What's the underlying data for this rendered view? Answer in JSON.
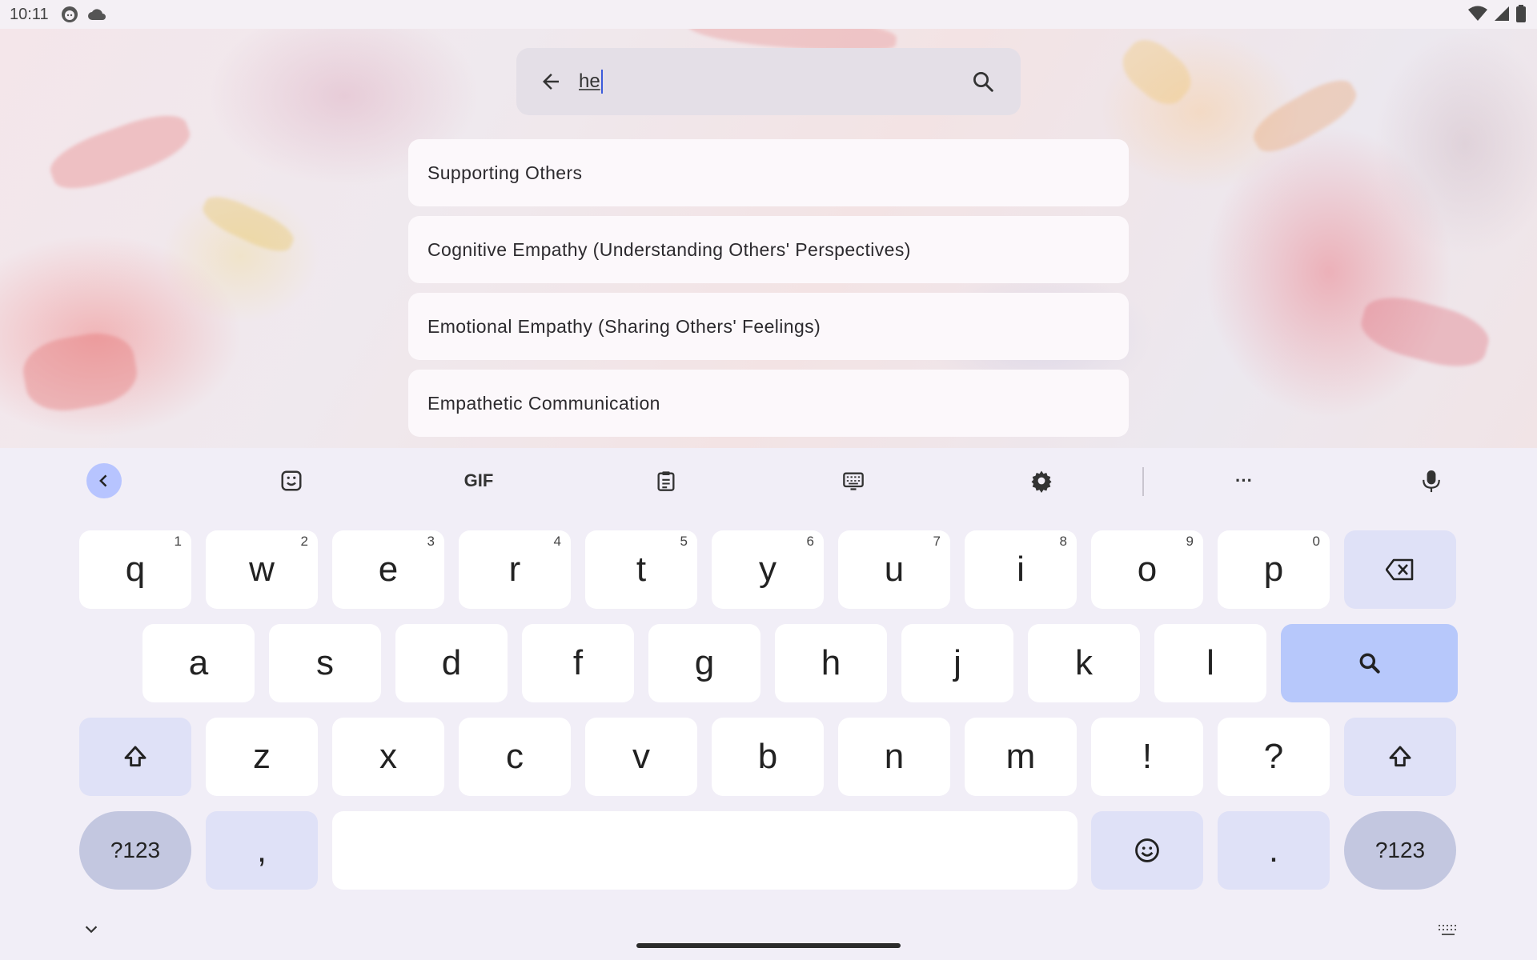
{
  "status_bar": {
    "time": "10:11"
  },
  "search": {
    "value": "he"
  },
  "suggestions": [
    "Supporting Others",
    "Cognitive Empathy (Understanding Others' Perspectives)",
    "Emotional Empathy (Sharing Others' Feelings)",
    "Empathetic Communication"
  ],
  "keyboard": {
    "toolbar": {
      "gif_label": "GIF",
      "more_label": "···"
    },
    "row1": [
      {
        "label": "q",
        "hint": "1"
      },
      {
        "label": "w",
        "hint": "2"
      },
      {
        "label": "e",
        "hint": "3"
      },
      {
        "label": "r",
        "hint": "4"
      },
      {
        "label": "t",
        "hint": "5"
      },
      {
        "label": "y",
        "hint": "6"
      },
      {
        "label": "u",
        "hint": "7"
      },
      {
        "label": "i",
        "hint": "8"
      },
      {
        "label": "o",
        "hint": "9"
      },
      {
        "label": "p",
        "hint": "0"
      }
    ],
    "row2": [
      "a",
      "s",
      "d",
      "f",
      "g",
      "h",
      "j",
      "k",
      "l"
    ],
    "row3": [
      "z",
      "x",
      "c",
      "v",
      "b",
      "n",
      "m",
      "!",
      "?"
    ],
    "symbols_label": "?123",
    "comma_label": ",",
    "period_label": "."
  },
  "colors": {
    "accent": "#b7c8fb",
    "modifier_key": "#dfe1f7",
    "symbol_key": "#c3c7e0",
    "keyboard_bg": "#f1eef7"
  }
}
